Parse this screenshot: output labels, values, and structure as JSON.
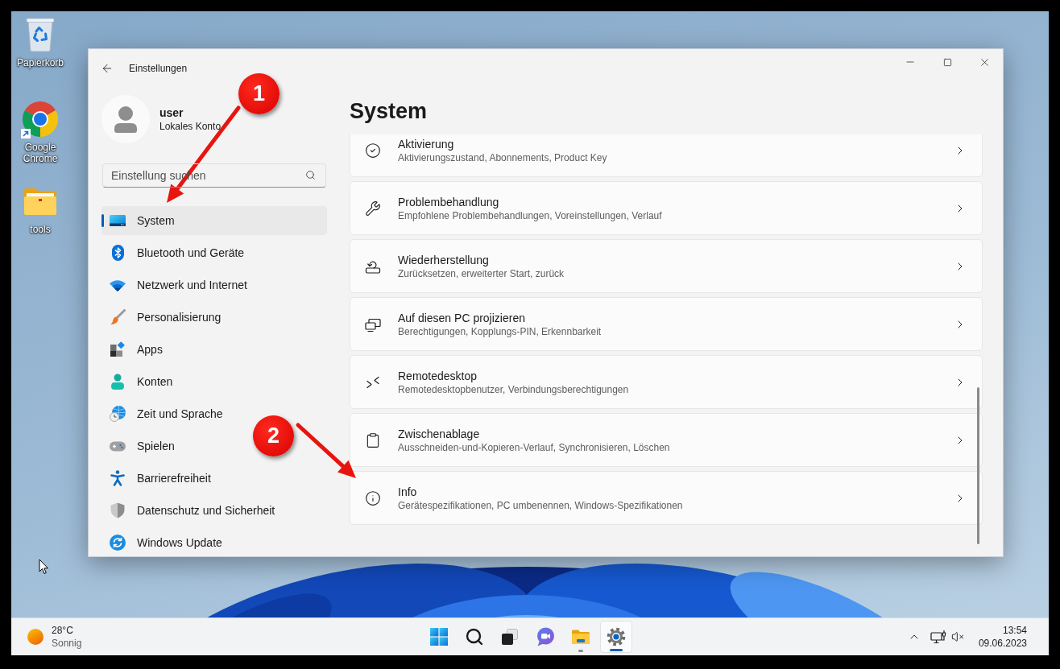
{
  "desktop": {
    "shortcuts": [
      {
        "label": "Papierkorb"
      },
      {
        "label": "Google Chrome"
      },
      {
        "label": "tools"
      }
    ]
  },
  "window": {
    "title": "Einstellungen"
  },
  "account": {
    "name": "user",
    "type": "Lokales Konto"
  },
  "search": {
    "placeholder": "Einstellung suchen"
  },
  "nav": [
    {
      "label": "System",
      "selected": true
    },
    {
      "label": "Bluetooth und Geräte",
      "selected": false
    },
    {
      "label": "Netzwerk und Internet",
      "selected": false
    },
    {
      "label": "Personalisierung",
      "selected": false
    },
    {
      "label": "Apps",
      "selected": false
    },
    {
      "label": "Konten",
      "selected": false
    },
    {
      "label": "Zeit und Sprache",
      "selected": false
    },
    {
      "label": "Spielen",
      "selected": false
    },
    {
      "label": "Barrierefreiheit",
      "selected": false
    },
    {
      "label": "Datenschutz und Sicherheit",
      "selected": false
    },
    {
      "label": "Windows Update",
      "selected": false
    }
  ],
  "page": {
    "title": "System"
  },
  "settings": [
    {
      "title": "Aktivierung",
      "description": "Aktivierungszustand, Abonnements, Product Key"
    },
    {
      "title": "Problembehandlung",
      "description": "Empfohlene Problembehandlungen, Voreinstellungen, Verlauf"
    },
    {
      "title": "Wiederherstellung",
      "description": "Zurücksetzen, erweiterter Start, zurück"
    },
    {
      "title": "Auf diesen PC projizieren",
      "description": "Berechtigungen, Kopplungs-PIN, Erkennbarkeit"
    },
    {
      "title": "Remotedesktop",
      "description": "Remotedesktopbenutzer, Verbindungsberechtigungen"
    },
    {
      "title": "Zwischenablage",
      "description": "Ausschneiden-und-Kopieren-Verlauf, Synchronisieren, Löschen"
    },
    {
      "title": "Info",
      "description": "Gerätespezifikationen, PC umbenennen, Windows-Spezifikationen"
    }
  ],
  "annotations": [
    {
      "label": "1"
    },
    {
      "label": "2"
    }
  ],
  "taskbar": {
    "weather": {
      "temperature": "28°C",
      "condition": "Sonnig"
    },
    "apps": [
      {
        "running": false,
        "selected": false
      },
      {
        "running": false,
        "selected": false
      },
      {
        "running": false,
        "selected": false
      },
      {
        "running": false,
        "selected": false
      },
      {
        "running": true,
        "selected": false
      },
      {
        "running": true,
        "selected": true
      }
    ],
    "clock": {
      "time": "13:54",
      "date": "09.06.2023"
    }
  }
}
